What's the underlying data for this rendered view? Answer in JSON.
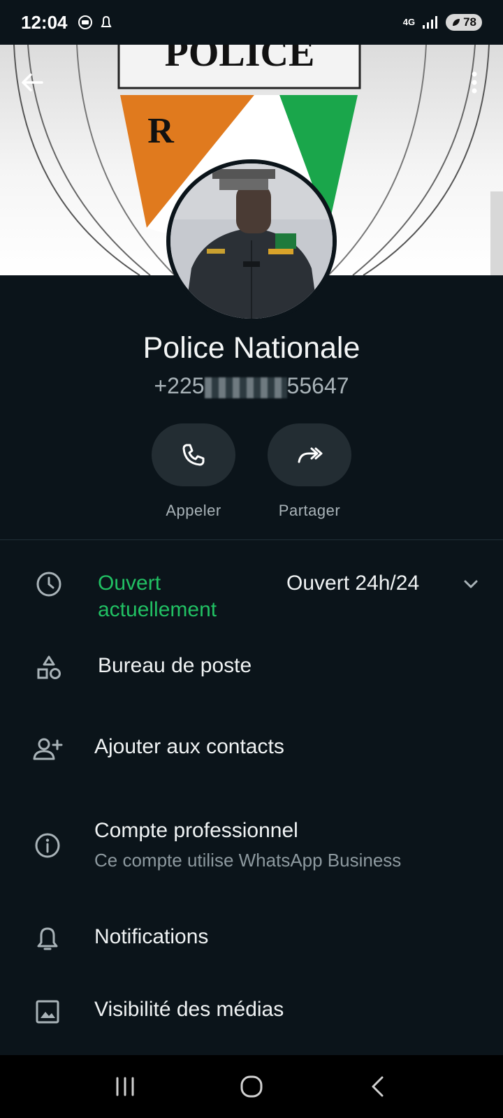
{
  "status_bar": {
    "time": "12:04",
    "network": "4G",
    "battery": "78"
  },
  "profile": {
    "name": "Police Nationale",
    "phone_prefix": "+225",
    "phone_suffix": "55647"
  },
  "actions": [
    {
      "label": "Appeler",
      "icon": "phone-icon"
    },
    {
      "label": "Partager",
      "icon": "share-icon"
    }
  ],
  "hours": {
    "status": "Ouvert actuellement",
    "detail": "Ouvert 24h/24"
  },
  "category": "Bureau de poste",
  "add_contact": "Ajouter aux contacts",
  "business": {
    "title": "Compte professionnel",
    "subtitle": "Ce compte utilise WhatsApp Business"
  },
  "notifications": "Notifications",
  "media_visibility": "Visibilité des médias",
  "cover_text": {
    "badge_title": "POLICE",
    "badge_letter": "R"
  },
  "colors": {
    "background": "#0b141a",
    "accent_green": "#21c063",
    "badge_orange": "#e07a1e",
    "badge_green": "#1aa64b"
  }
}
